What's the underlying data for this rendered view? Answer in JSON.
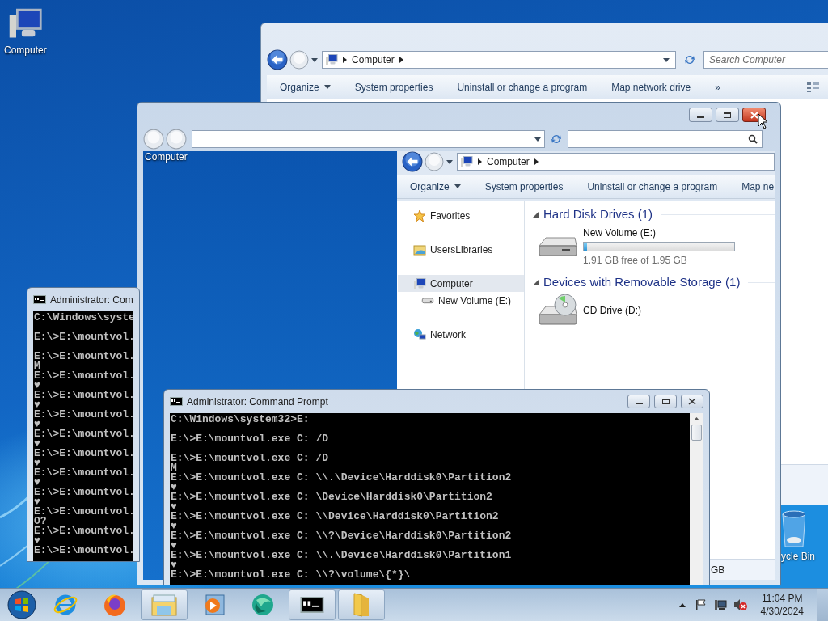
{
  "desktop_icons": [
    {
      "label": "Computer",
      "kind": "computer"
    },
    {
      "label": "ycle Bin",
      "kind": "recycle-bin"
    }
  ],
  "back_explorer": {
    "breadcrumb": "Computer",
    "search": {
      "placeholder": "Search Computer"
    },
    "toolbar": [
      {
        "label": "Organize",
        "dropdown": true
      },
      {
        "label": "System properties",
        "dropdown": false
      },
      {
        "label": "Uninstall or change a program",
        "dropdown": false
      },
      {
        "label": "Map network drive",
        "dropdown": false
      },
      {
        "label": "»",
        "dropdown": false
      }
    ]
  },
  "ghost_window": {
    "desktop_label": "Computer",
    "explorer": {
      "breadcrumb": "Computer",
      "toolbar": [
        {
          "label": "Organize",
          "dropdown": true
        },
        {
          "label": "System properties",
          "dropdown": false
        },
        {
          "label": "Uninstall or change a program",
          "dropdown": false
        },
        {
          "label": "Map ne",
          "dropdown": false
        }
      ],
      "nav": [
        {
          "label": "Favorites",
          "kind": "star",
          "selected": false
        },
        {
          "label": "UsersLibraries",
          "kind": "library",
          "selected": false
        },
        {
          "label": "Computer",
          "kind": "computer",
          "selected": true,
          "children": [
            {
              "label": "New Volume (E:)",
              "kind": "drive",
              "selected": false
            }
          ]
        },
        {
          "label": "Network",
          "kind": "network",
          "selected": false
        }
      ],
      "groups": [
        {
          "title": "Hard Disk Drives (1)",
          "items": [
            {
              "name": "New Volume (E:)",
              "kind": "hdd",
              "level": 0.02,
              "detail": "1.91 GB free of 1.95 GB"
            }
          ]
        },
        {
          "title": "Devices with Removable Storage (1)",
          "items": [
            {
              "name": "CD Drive (D:)",
              "kind": "cd"
            }
          ]
        }
      ],
      "status": "GB"
    }
  },
  "cmd_windows": [
    {
      "title": "Administrator: Com",
      "entries": [
        {
          "command": "C:\\Windows\\syste"
        },
        {
          "command": "E:\\>E:\\mountvol."
        },
        {
          "command": "E:\\>E:\\mountvol.",
          "output": "M"
        },
        {
          "command": "E:\\>E:\\mountvol.",
          "output": "♥"
        },
        {
          "command": "E:\\>E:\\mountvol.",
          "output": "♥"
        },
        {
          "command": "E:\\>E:\\mountvol.",
          "output": "♥"
        },
        {
          "command": "E:\\>E:\\mountvol.",
          "output": "♥"
        },
        {
          "command": "E:\\>E:\\mountvol.",
          "output": "♥"
        },
        {
          "command": "E:\\>E:\\mountvol.",
          "output": "♥"
        },
        {
          "command": "E:\\>E:\\mountvol.",
          "output": "♥"
        },
        {
          "command": "E:\\>E:\\mountvol.",
          "output": "O?"
        },
        {
          "command": "E:\\>E:\\mountvol.",
          "output": "♥"
        },
        {
          "command": "E:\\>E:\\mountvol."
        }
      ]
    },
    {
      "title": "Administrator: Command Prompt",
      "entries": [
        {
          "command": "C:\\Windows\\system32>E:"
        },
        {
          "command": "E:\\>E:\\mountvol.exe C: /D"
        },
        {
          "command": "E:\\>E:\\mountvol.exe C: /D",
          "output": "M"
        },
        {
          "command": "E:\\>E:\\mountvol.exe C: \\\\.\\Device\\Harddisk0\\Partition2",
          "output": "♥"
        },
        {
          "command": "E:\\>E:\\mountvol.exe C: \\Device\\Harddisk0\\Partition2",
          "output": "♥"
        },
        {
          "command": "E:\\>E:\\mountvol.exe C: \\\\Device\\Harddisk0\\Partition2",
          "output": "♥"
        },
        {
          "command": "E:\\>E:\\mountvol.exe C: \\\\?\\Device\\Harddisk0\\Partition2",
          "output": "♥"
        },
        {
          "command": "E:\\>E:\\mountvol.exe C: \\\\.\\Device\\Harddisk0\\Partition1",
          "output": "♥"
        },
        {
          "command": "E:\\>E:\\mountvol.exe C: \\\\?\\volume\\{*}\\"
        }
      ]
    }
  ],
  "taskbar": {
    "apps": [
      {
        "kind": "ie",
        "active": false
      },
      {
        "kind": "firefox",
        "active": false
      },
      {
        "kind": "explorer",
        "active": true
      },
      {
        "kind": "media",
        "active": false
      },
      {
        "kind": "green",
        "active": false
      },
      {
        "kind": "cmd",
        "active": true
      },
      {
        "kind": "folder",
        "active": true
      }
    ],
    "clock": {
      "time": "11:04 PM",
      "date": "4/30/2024"
    }
  }
}
